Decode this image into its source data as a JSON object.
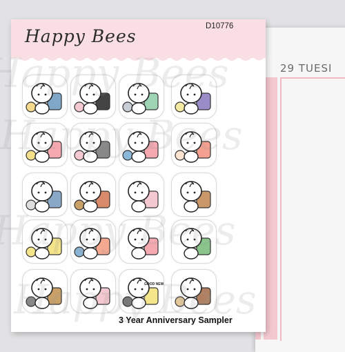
{
  "sheet": {
    "brand": "Happy Bees",
    "code": "D10776",
    "title": "3 Year Anniversary Sampler"
  },
  "planner": {
    "day_text": "29 TUESI"
  },
  "watermark": {
    "text": "Happy Bees"
  },
  "stickers": [
    {
      "name": "crafting",
      "colors": [
        "#7fa8c8",
        "#f4d98a",
        "#a8a8d0"
      ]
    },
    {
      "name": "movie-night",
      "colors": [
        "#444",
        "#f4c8d0",
        "#c99a6a"
      ]
    },
    {
      "name": "travel-suitcase",
      "colors": [
        "#9ed4b4",
        "#c8ccd4"
      ]
    },
    {
      "name": "home",
      "colors": [
        "#9a8cc8",
        "#f4e9a0",
        "#c8b8e4"
      ]
    },
    {
      "name": "planning-notes",
      "colors": [
        "#f4a8b0",
        "#f4e08a",
        "#c8a0e0"
      ]
    },
    {
      "name": "laptop-storm",
      "colors": [
        "#888",
        "#f4c8d0"
      ]
    },
    {
      "name": "phone-selfie",
      "colors": [
        "#f4a8b0",
        "#8ab8d8"
      ]
    },
    {
      "name": "blanket-cozy",
      "colors": [
        "#f4a090",
        "#fbe3d0"
      ]
    },
    {
      "name": "charging",
      "colors": [
        "#8aa8c8",
        "#ddd"
      ]
    },
    {
      "name": "apple-reward",
      "colors": [
        "#d88a6a",
        "#c8a068"
      ]
    },
    {
      "name": "friends-chat",
      "colors": [
        "#f4c8d0"
      ]
    },
    {
      "name": "coffee-mug",
      "colors": [
        "#c89868"
      ]
    },
    {
      "name": "sick-day",
      "colors": [
        "#f4e48a",
        "#f4e48a"
      ]
    },
    {
      "name": "peach-scrapbook",
      "colors": [
        "#f4a890",
        "#8ab4d4"
      ]
    },
    {
      "name": "heart-love",
      "colors": [
        "#f4a8b0"
      ]
    },
    {
      "name": "money-cash",
      "colors": [
        "#8ac48a"
      ]
    },
    {
      "name": "journal-pens",
      "colors": [
        "#c8a068",
        "#888"
      ]
    },
    {
      "name": "reading",
      "colors": [
        "#f4c8d0"
      ]
    },
    {
      "name": "newspaper",
      "colors": [
        "#f4e48a",
        "#777"
      ],
      "label": "GOOD NEWS"
    },
    {
      "name": "jenga-bear",
      "colors": [
        "#b08060",
        "#e4c89a"
      ]
    }
  ]
}
